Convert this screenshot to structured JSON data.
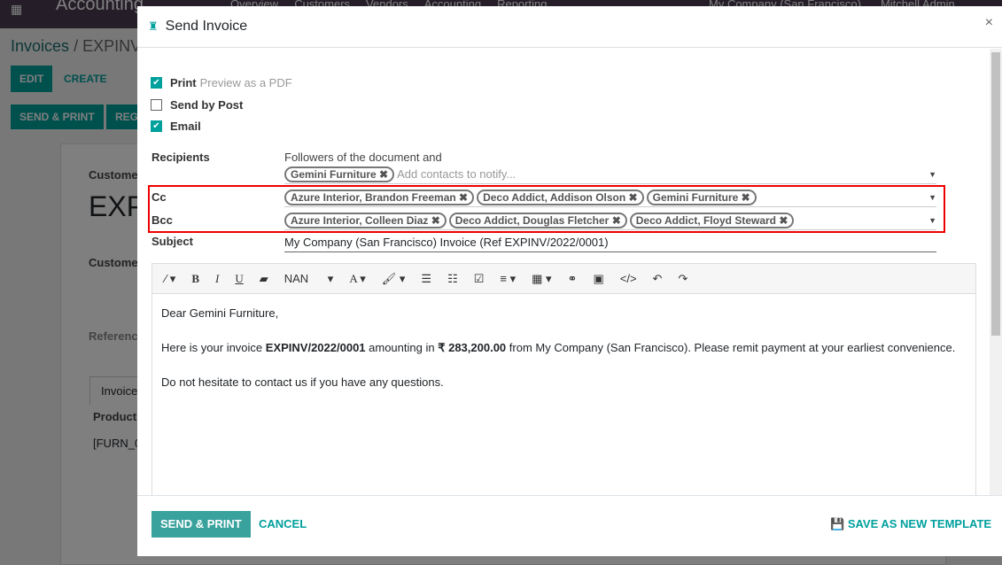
{
  "background": {
    "app": "Accounting",
    "menu": [
      "Overview",
      "Customers",
      "Vendors",
      "Accounting",
      "Reporting"
    ],
    "company": "My Company (San Francisco)",
    "user": "Mitchell Admin",
    "breadcrumb": [
      "Invoices",
      "/ EXPINV"
    ],
    "edit": "EDIT",
    "create": "CREATE",
    "send_print": "SEND & PRINT",
    "register": "REG",
    "customer_label": "Customer",
    "title": "EXP",
    "customer_label2": "Customer",
    "reference": "Reference",
    "tab": "Invoice",
    "product": "Product",
    "product_row": "[FURN_0"
  },
  "modal": {
    "title": "Send Invoice",
    "close": "×",
    "options": [
      {
        "label": "Print",
        "hint": "Preview as a PDF",
        "checked": true
      },
      {
        "label": "Send by Post",
        "hint": "",
        "checked": false
      },
      {
        "label": "Email",
        "hint": "",
        "checked": true
      }
    ],
    "recipients_label": "Recipients",
    "recipients_text": "Followers of the document and",
    "recipients": [
      "Gemini Furniture"
    ],
    "recipients_placeholder": "Add contacts to notify...",
    "cc_label": "Cc",
    "cc": [
      "Azure Interior, Brandon Freeman",
      "Deco Addict, Addison Olson",
      "Gemini Furniture"
    ],
    "bcc_label": "Bcc",
    "bcc": [
      "Azure Interior, Colleen Diaz",
      "Deco Addict, Douglas Fletcher",
      "Deco Addict, Floyd Steward"
    ],
    "subject_label": "Subject",
    "subject": "My Company (San Francisco) Invoice (Ref EXPINV/2022/0001)",
    "toolbar": {
      "font_size": "NAN"
    },
    "body": {
      "greeting": "Dear Gemini Furniture,",
      "p1_a": "Here is your invoice ",
      "p1_ref": "EXPINV/2022/0001",
      "p1_b": " amounting in ",
      "p1_amount": "₹ 283,200.00",
      "p1_c": " from My Company (San Francisco). Please remit payment at your earliest convenience.",
      "p2": "Do not hesitate to contact us if you have any questions."
    },
    "footer": {
      "send_print": "SEND & PRINT",
      "cancel": "CANCEL",
      "save_template": "SAVE AS NEW TEMPLATE"
    }
  },
  "colors": {
    "accent": "#00a09d",
    "highlight": "#e00000"
  }
}
